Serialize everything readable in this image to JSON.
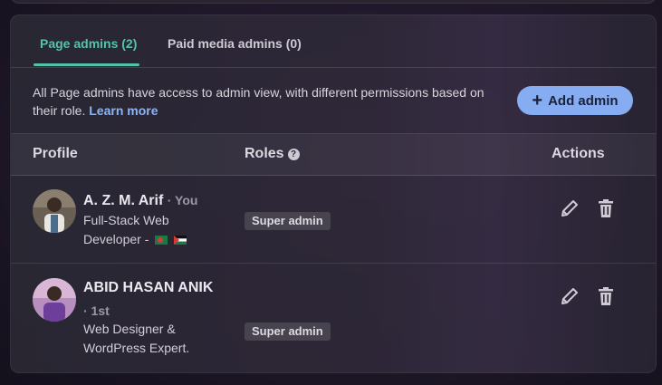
{
  "tabs": [
    {
      "label": "Page admins (2)"
    },
    {
      "label": "Paid media admins (0)"
    }
  ],
  "info": {
    "text": "All Page admins have access to admin view, with different permissions based on their role.",
    "link": "Learn more"
  },
  "add_button": {
    "label": "Add admin",
    "icon": "plus-icon"
  },
  "table": {
    "headers": {
      "profile": "Profile",
      "roles": "Roles",
      "actions": "Actions"
    },
    "rows": [
      {
        "name": "A. Z. M. Arif",
        "meta": "· You",
        "desc_line1": "Full-Stack Web",
        "desc_line2": "Developer -",
        "flags": [
          "bangladesh-flag",
          "palestine-flag"
        ],
        "role": "Super admin"
      },
      {
        "name": "ABID HASAN ANIK",
        "meta": "· 1st",
        "desc_line1": "Web Designer &",
        "desc_line2": "WordPress Expert.",
        "role": "Super admin"
      }
    ]
  },
  "colors": {
    "accent": "#55c3a7",
    "button": "#86adf2",
    "link": "#8fb4f0"
  }
}
